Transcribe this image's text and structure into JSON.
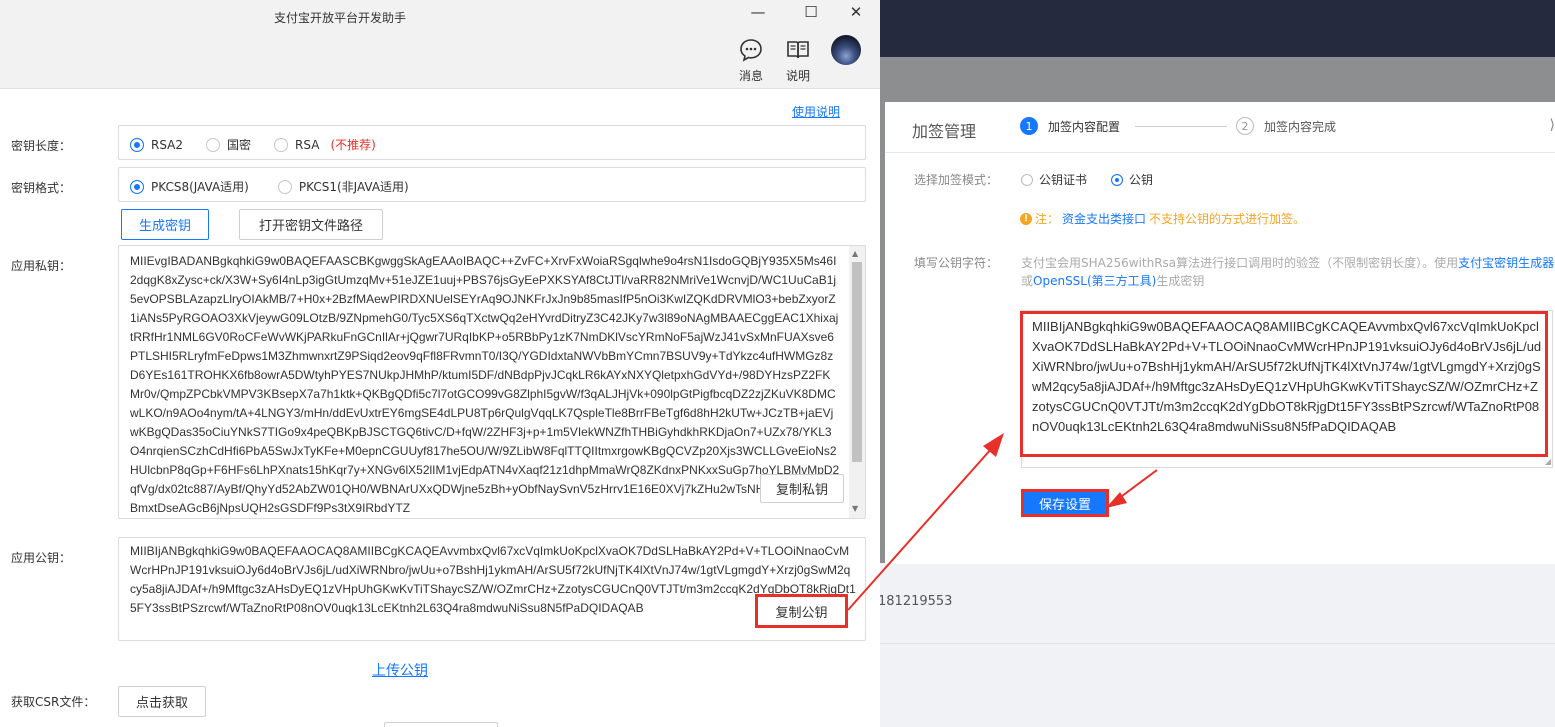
{
  "app": {
    "title": "支付宝开放平台开发助手",
    "window_controls": {
      "minimize": "—",
      "maximize": "☐",
      "close": "✕"
    },
    "toolbar": {
      "messages": "消息",
      "guide": "说明"
    },
    "help_link": "使用说明",
    "key_length": {
      "label": "密钥长度：",
      "options": [
        {
          "text": "RSA2",
          "selected": true
        },
        {
          "text": "国密",
          "selected": false
        },
        {
          "text": "RSA",
          "selected": false
        }
      ],
      "note": "(不推荐)"
    },
    "key_format": {
      "label": "密钥格式：",
      "options": [
        {
          "text": "PKCS8(JAVA适用)",
          "selected": true
        },
        {
          "text": "PKCS1(非JAVA适用)",
          "selected": false
        }
      ]
    },
    "generate_button": "生成密钥",
    "open_path_button": "打开密钥文件路径",
    "private_key": {
      "label": "应用私钥：",
      "value": "MIIEvgIBADANBgkqhkiG9w0BAQEFAASCBKgwggSkAgEAAoIBAQC++ZvFC+XrvFxWoiaRSgqlwhe9o4rsN1IsdoGQBjY935X5Ms46I2dqgK8xZysc+ck/X3W+Sy6I4nLp3igGtUmzqMv+51eJZE1uuj+PBS76jsGyEePXKSYAf8CtJTl/vaRR82NMriVe1WcnvjD/WC1UuCaB1j5evOPSBLAzapzLlryOIAkMB/7+H0x+2BzfMAewPIRDXNUelSEYrAq9OJNKFrJxJn9b85masIfP5nOi3KwIZQKdDRVMlO3+bebZxyorZ1iANs5PyRGOAO3XkVjeywG09LOtzB/9ZNpmehG0/Tyc5XS6qTXctwQq2eHYvrdDitryZ3C42JKy7w3l89oNAgMBAAECggEAC1XhixajtRRfHr1NML6GV0RoCFeWvWKjPARkuFnGCnIlAr+jQgwr7URqIbKP+o5RBbPy1zK7NmDKlVscYRmNoF5ajWzJ41vSxMnFUAXsve6PTLSHI5RLryfmFeDpws1M3ZhmwnxrtZ9PSiqd2eov9qFfl8FRvmnT0/I3Q/YGDIdxtaNWVbBmYCmn7BSUV9y+TdYkzc4ufHWMGz8zD6YEs161TROHKX6fb8owrA5DWtyhPYES7NUkpJHMhP/ktumI5DF/dNBdpPjvJCqkLR6kAYxNXYQletpxhGdVYd+/98DYHzsPZ2FKMr0v/QmpZPCbkVMPV3KBsepX7a7h1ktk+QKBgQDfi5c7l7otGCO99vG8ZlphI5gvW/f3qALJHjVk+090lpGtPigfbcqDZ2zjZKuVK8DMCwLKO/n9AOo4nym/tA+4LNGY3/mHn/ddEvUxtrEY6mgSE4dLPU8Tp6rQulgVqqLK7QspleTle8BrrFBeTgf6d8hH2kUTw+JCzTB+jaEVjwKBgQDas35oCiuYNkS7TIGo9x4peQBKpBJSCTGQ6tivC/D+fqW/2ZHF3j+p+1m5VIekWNZfhTHBiGyhdkhRKDjaOn7+UZx78/YKL3O4nrqienSCzhCdHfi6PbA5SwJxTyKFe+M0epnCGUUyf817he5OU/W/9ZLibW8FqlTTQIItmxrgowKBgQCVZp20Xjs3WCLLGveEioNs2HUlcbnP8qGp+F6HFs6LhPXnats15hKqr7y+XNGv6lX52lIM1vjEdpATN4vXaqf21z1dhpMmaWrQ8ZKdnxPNKxxSuGp7hoYLBMvMpD2qfVg/dx02tc887/AyBf/QhyYd52AbZW01QH0/WBNArUXxQDWjne5zBh+yObfNaySvnV5zHrrv1E16E0XVj7kZHu2wTsNH37ytxqQQcYBmxtDseAGcB6jNpsUQH2sGSDFf9Ps3tX9IRbdYTZ",
      "copy_button": "复制私钥"
    },
    "public_key": {
      "label": "应用公钥：",
      "value": "MIIBIjANBgkqhkiG9w0BAQEFAAOCAQ8AMIIBCgKCAQEAvvmbxQvl67xcVqImkUoKpclXvaOK7DdSLHaBkAY2Pd+V+TLOOiNnaoCvMWcrHPnJP191vksuiOJy6d4oBrVJs6jL/udXiWRNbro/jwUu+o7BshHj1ykmAH/ArSU5f72kUfNjTK4lXtVnJ74w/1gtVLgmgdY+Xrzj0gSwM2qcy5a8jiAJDAf+/h9Mftgc3zAHsDyEQ1zVHpUhGKwKvTiTShaycSZ/W/OZmrCHz+ZzotysCGUCnQ0VTJTt/m3m2ccqK2dYgDbOT8kRjgDt15FY3ssBtPSzrcwf/WTaZnoRtP08nOV0uqk13LcEKtnh2L63Q4ra8mdwuNiSsu8N5fPaDQIDAQAB",
      "copy_button": "复制公钥"
    },
    "upload_link": "上传公钥",
    "csr": {
      "label": "获取CSR文件：",
      "button": "点击获取"
    }
  },
  "console": {
    "phone_fragment": "181219553",
    "modal": {
      "title": "加签管理",
      "steps": [
        {
          "num": "1",
          "label": "加签内容配置"
        },
        {
          "num": "2",
          "label": "加签内容完成"
        }
      ],
      "mode": {
        "label": "选择加签模式：",
        "options": [
          {
            "text": "公钥证书",
            "selected": false
          },
          {
            "text": "公钥",
            "selected": true
          }
        ]
      },
      "note": {
        "icon": "!",
        "prefix": "注：",
        "link": "资金支出类接口",
        "suffix": "不支持公钥的方式进行加签。"
      },
      "public_key_field": {
        "label": "填写公钥字符：",
        "desc_part1": "支付宝会用SHA256withRsa算法进行接口调用时的验签（不限制密钥长度）。使用",
        "desc_link1": "支付宝密钥生成器",
        "desc_part2": "或",
        "desc_link2": "OpenSSL(第三方工具)",
        "desc_part3": "生成密钥",
        "value": "MIIBIjANBgkqhkiG9w0BAQEFAAOCAQ8AMIIBCgKCAQEAvvmbxQvl67xcVqImkUoKpclXvaOK7DdSLHaBkAY2Pd+V+TLOOiNnaoCvMWcrHPnJP191vksuiOJy6d4oBrVJs6jL/udXiWRNbro/jwUu+o7BshHj1ykmAH/ArSU5f72kUfNjTK4lXtVnJ74w/1gtVLgmgdY+Xrzj0gSwM2qcy5a8jiAJDAf+/h9Mftgc3zAHsDyEQ1zVHpUhGKwKvTiTShaycSZ/W/OZmrCHz+ZzotysCGUCnQ0VTJTt/m3m2ccqK2dYgDbOT8kRjgDt15FY3ssBtPSzrcwf/WTaZnoRtP08nOV0uqk13LcEKtnh2L63Q4ra8mdwuNiSsu8N5fPaDQIDAQAB"
      },
      "save_button": "保存设置"
    }
  },
  "colors": {
    "accent": "#1677ff",
    "highlight": "#e8302a",
    "warning": "#f5a623"
  }
}
